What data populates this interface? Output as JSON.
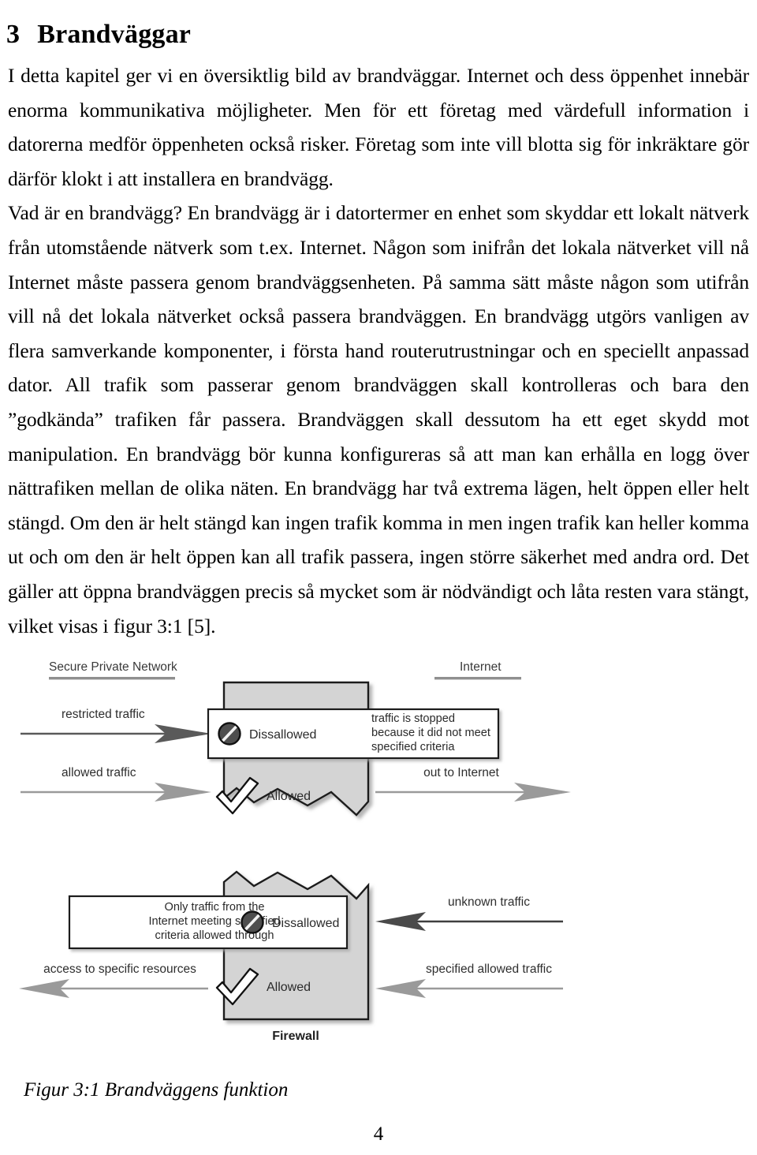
{
  "document": {
    "chapter_number": "3",
    "chapter_title": "Brandväggar",
    "paragraphs": [
      "I detta kapitel ger vi en översiktlig bild av brandväggar. Internet och dess öppenhet innebär enorma kommunikativa möjligheter. Men för ett företag med värdefull information i datorerna medför öppenheten också risker. Företag som inte vill blotta sig för inkräktare gör därför klokt i att installera en brandvägg.",
      "Vad är en brandvägg? En brandvägg är i datortermer en enhet som skyddar ett lokalt nätverk från utomstående nätverk som t.ex. Internet. Någon som inifrån det lokala nätverket vill nå Internet måste passera genom brandväggsenheten. På samma sätt måste någon som utifrån vill nå det lokala nätverket också passera brandväggen. En brandvägg utgörs vanligen av flera samverkande komponenter, i första hand routerutrustningar och en speciellt anpassad dator. All trafik som passerar genom brandväggen skall kontrolleras och bara den ”godkända” trafiken får passera. Brandväggen skall dessutom ha ett eget skydd mot manipulation. En brandvägg bör kunna konfigureras så att man kan erhålla en logg över nättrafiken mellan de olika näten. En brandvägg har två extrema lägen, helt öppen eller helt stängd. Om den är helt stängd kan ingen trafik komma in men ingen trafik kan heller komma ut och om den är helt öppen kan all trafik passera, ingen större säkerhet med andra ord. Det gäller att öppna brandväggen precis så mycket som är nödvändigt och låta resten vara stängt, vilket visas i figur 3:1 [5]."
    ],
    "figure_caption": "Figur 3:1 Brandväggens funktion",
    "page_number": "4"
  },
  "figure": {
    "zone_labels": {
      "left": "Secure Private Network",
      "right": "Internet"
    },
    "firewall_label": "Firewall",
    "arrows": [
      {
        "id": "restricted-traffic",
        "label": "restricted traffic",
        "direction": "right",
        "tone": "dark"
      },
      {
        "id": "allowed-traffic",
        "label": "allowed traffic",
        "direction": "right",
        "tone": "light"
      },
      {
        "id": "out-to-internet",
        "label": "out to Internet",
        "direction": "right",
        "tone": "light"
      },
      {
        "id": "unknown-traffic",
        "label": "unknown traffic",
        "direction": "left",
        "tone": "dark"
      },
      {
        "id": "specified-allowed-traffic",
        "label": "specified allowed traffic",
        "direction": "left",
        "tone": "light"
      },
      {
        "id": "access-to-specific-resources",
        "label": "access to specific resources",
        "direction": "left",
        "tone": "light"
      }
    ],
    "decisions": [
      {
        "id": "upper-dissallowed",
        "label": "Dissallowed",
        "icon": "no-entry-icon"
      },
      {
        "id": "upper-allowed",
        "label": "Allowed",
        "icon": "checkmark-icon"
      },
      {
        "id": "lower-dissallowed",
        "label": "Dissallowed",
        "icon": "no-entry-icon"
      },
      {
        "id": "lower-allowed",
        "label": "Allowed",
        "icon": "checkmark-icon"
      }
    ],
    "callouts": [
      {
        "id": "stopped-callout",
        "lines": [
          "traffic is stopped",
          "because it did not meet",
          "specified criteria"
        ]
      },
      {
        "id": "allowed-through-callout",
        "lines": [
          "Only traffic from the",
          "Internet meeting specified",
          "criteria allowed through"
        ]
      }
    ],
    "colors": {
      "firewall_fill": "#d4d4d4",
      "outline": "#1a1a1a",
      "arrow_dark": "#5a5a5a",
      "arrow_light": "#9a9a9a",
      "callout_fill": "#ffffff"
    }
  }
}
